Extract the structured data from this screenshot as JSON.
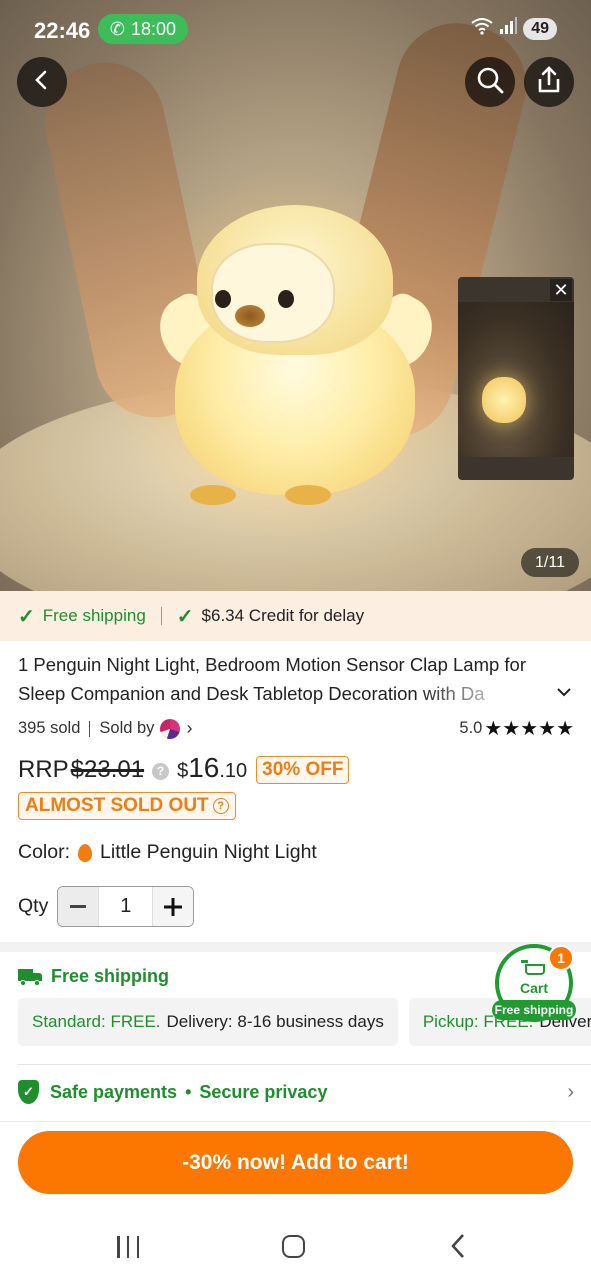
{
  "status_bar": {
    "time": "22:46",
    "call_timer": "18:00",
    "battery": "49"
  },
  "hero": {
    "image_counter": "1/11"
  },
  "benefits": {
    "free_shipping": "Free shipping",
    "credit_for_delay": "$6.34 Credit for delay"
  },
  "product": {
    "title": "1 Penguin Night Light, Bedroom Motion Sensor Clap Lamp for Sleep Companion and Desk Tabletop Decoration with Da",
    "sold_count": "395 sold",
    "sold_by_label": "Sold by",
    "rating": "5.0",
    "stars": "★★★★★",
    "rrp_label": "RRP",
    "rrp_price": "$23.01",
    "sale_currency": "$",
    "sale_main": "16",
    "sale_cents": ".10",
    "discount": "30% OFF",
    "stock_status": "ALMOST SOLD OUT",
    "color_label": "Color:",
    "color_value": "Little Penguin Night Light",
    "qty_label": "Qty",
    "qty_value": "1"
  },
  "shipping": {
    "heading": "Free shipping",
    "standard_label": "Standard: FREE.",
    "standard_delivery": "Delivery: 8-16 business days",
    "pickup_label": "Pickup: FREE.",
    "pickup_delivery": "Delivery"
  },
  "safety": {
    "payments": "Safe payments",
    "separator": "•",
    "privacy": "Secure privacy"
  },
  "cart": {
    "label": "Cart",
    "badge_count": "1",
    "free_shipping_tag": "Free shipping"
  },
  "cta": {
    "label": "-30% now! Add to cart!"
  },
  "colors": {
    "accent_orange": "#fb7701",
    "success_green": "#1f8f2e",
    "benefits_bg": "#fdeee2"
  }
}
